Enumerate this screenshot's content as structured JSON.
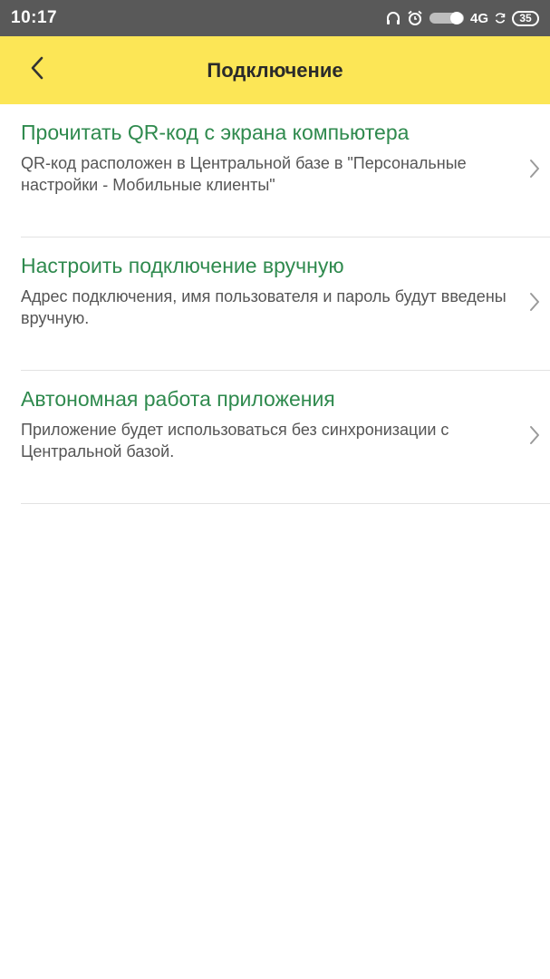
{
  "status_bar": {
    "time": "10:17",
    "network": "4G",
    "battery": "35",
    "icons": [
      "headphones-icon",
      "alarm-icon",
      "toggle-icon",
      "sync-icon"
    ]
  },
  "app_bar": {
    "title": "Подключение",
    "back_icon": "chevron-left-icon",
    "background": "#fce656"
  },
  "options": [
    {
      "title": "Прочитать QR-код с экрана компьютера",
      "description": "QR-код расположен в Центральной базе в \"Персональные настройки - Мобильные клиенты\""
    },
    {
      "title": "Настроить подключение вручную",
      "description": "Адрес подключения, имя пользователя и пароль будут введены вручную."
    },
    {
      "title": "Автономная работа приложения",
      "description": "Приложение будет использоваться без синхронизации с Центральной базой."
    }
  ],
  "colors": {
    "accent_green": "#2f8a4e",
    "description_gray": "#555555",
    "status_bar": "#595959"
  }
}
